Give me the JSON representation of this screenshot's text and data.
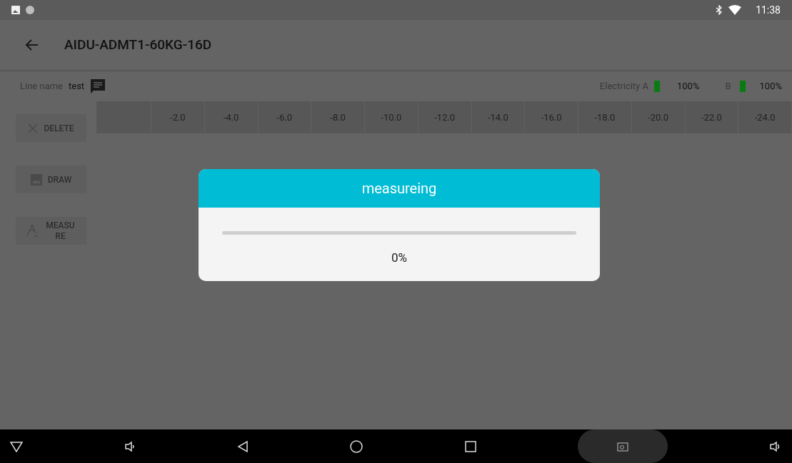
{
  "status_bar": {
    "time": "11:38"
  },
  "toolbar": {
    "title": "AIDU-ADMT1-60KG-16D"
  },
  "info_row": {
    "line_name_label": "Line name",
    "line_name": "test",
    "electricity_label": "Electricity A",
    "battery_a": {
      "level": 1,
      "reading": "100%"
    },
    "battery_b_label": "B",
    "battery_b": {
      "level": 1,
      "reading": "100%"
    }
  },
  "side_buttons": [
    {
      "label": "DELETE",
      "kind": "delete"
    },
    {
      "label": "DRAW",
      "kind": "draw"
    },
    {
      "label": "MEASURE",
      "kind": "measure"
    }
  ],
  "table": {
    "columns": [
      "-2.0",
      "-4.0",
      "-6.0",
      "-8.0",
      "-10.0",
      "-12.0",
      "-14.0",
      "-16.0",
      "-18.0",
      "-20.0",
      "-22.0",
      "-24.0"
    ]
  },
  "dialog": {
    "title": "measureing",
    "progress": {
      "level": 0
    },
    "reading": "0%"
  }
}
